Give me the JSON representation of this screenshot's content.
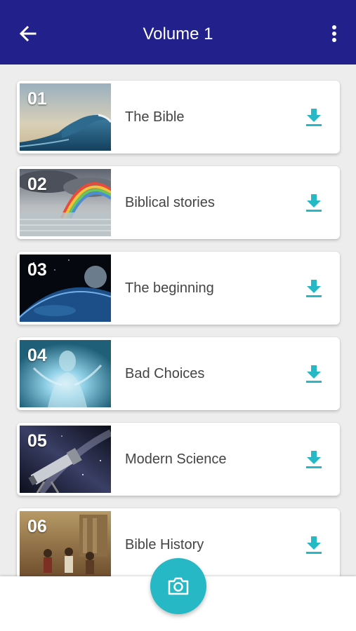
{
  "header": {
    "title": "Volume 1",
    "back_icon": "arrow-back-icon",
    "menu_icon": "more-vert-icon",
    "background_color": "#22208a"
  },
  "items": [
    {
      "number": "01",
      "title": "The Bible",
      "image": "ocean-wave",
      "action_icon": "download-icon"
    },
    {
      "number": "02",
      "title": "Biblical stories",
      "image": "rainbow-storm",
      "action_icon": "download-icon"
    },
    {
      "number": "03",
      "title": "The beginning",
      "image": "planet-earth-space",
      "action_icon": "download-icon"
    },
    {
      "number": "04",
      "title": "Bad Choices",
      "image": "glowing-figure",
      "action_icon": "download-icon"
    },
    {
      "number": "05",
      "title": "Modern Science",
      "image": "telescope-galaxy",
      "action_icon": "download-icon"
    },
    {
      "number": "06",
      "title": "Bible History",
      "image": "ancient-painting",
      "action_icon": "download-icon"
    }
  ],
  "fab": {
    "icon": "camera-icon",
    "color": "#27b8c5"
  },
  "accent_color": "#27b8c5"
}
